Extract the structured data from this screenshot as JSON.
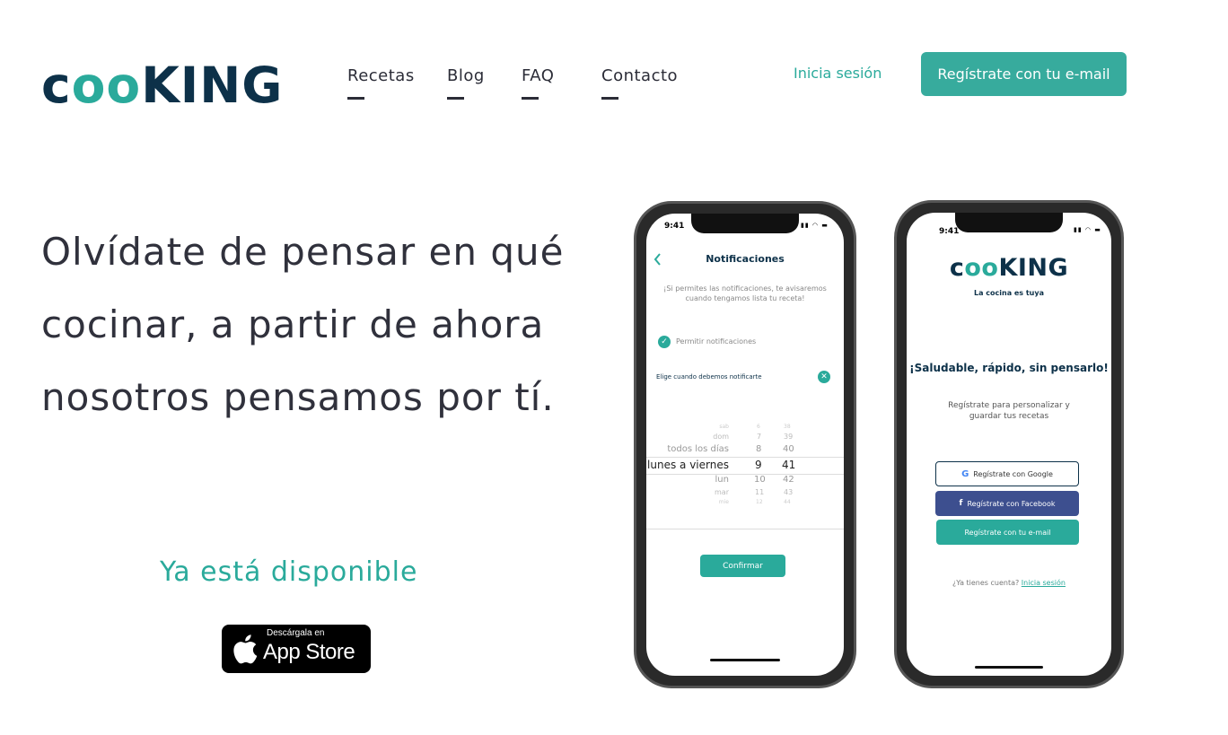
{
  "logo": {
    "part1": "c",
    "part2": "oo",
    "part3": "KING"
  },
  "nav": [
    {
      "label": "Recetas"
    },
    {
      "label": "Blog"
    },
    {
      "label": "FAQ"
    },
    {
      "label": "Contacto"
    }
  ],
  "header": {
    "login_label": "Inicia sesión",
    "signup_label": "Regístrate con tu e-mail"
  },
  "hero": {
    "line1": "Olvídate de pensar en qué",
    "line2": "cocinar, a partir de ahora",
    "line3": "nosotros pensamos por tí."
  },
  "availability": "Ya está disponible",
  "app_store": {
    "small": "Descárgala en",
    "big": "App Store",
    "icon": "apple-icon"
  },
  "colors": {
    "accent": "#2aaa9b",
    "dark": "#0d3149",
    "facebook": "#3d4f8f"
  },
  "phone1": {
    "time": "9:41",
    "title": "Notificaciones",
    "desc_line1": "¡Si permites las notificaciones, te avisaremos",
    "desc_line2": "cuando tengamos lista tu receta!",
    "allow_label": "Permitir notificaciones",
    "choose_label": "Elige cuando debemos notificarte",
    "picker": [
      {
        "a": "sab",
        "b": "6",
        "c": "38"
      },
      {
        "a": "dom",
        "b": "7",
        "c": "39"
      },
      {
        "a": "todos los días",
        "b": "8",
        "c": "40"
      },
      {
        "a": "lunes a  viernes",
        "b": "9",
        "c": "41"
      },
      {
        "a": "lun",
        "b": "10",
        "c": "42"
      },
      {
        "a": "mar",
        "b": "11",
        "c": "43"
      },
      {
        "a": "mie",
        "b": "12",
        "c": "44"
      }
    ],
    "confirm_label": "Confirmar"
  },
  "phone2": {
    "time": "9:41",
    "logo": {
      "part1": "c",
      "part2": "oo",
      "part3": "KING"
    },
    "tagline": "La cocina es tuya",
    "headline": "¡Saludable, rápido, sin pensarlo!",
    "desc_line1": "Regístrate para personalizar y",
    "desc_line2": "guardar tus recetas",
    "google_label": "Regístrate con Google",
    "facebook_label": "Regístrate con Facebook",
    "email_label": "Regístrate con tu e-mail",
    "account_q": "¿Ya tienes cuenta?",
    "login_link": "Inicia sesión"
  }
}
